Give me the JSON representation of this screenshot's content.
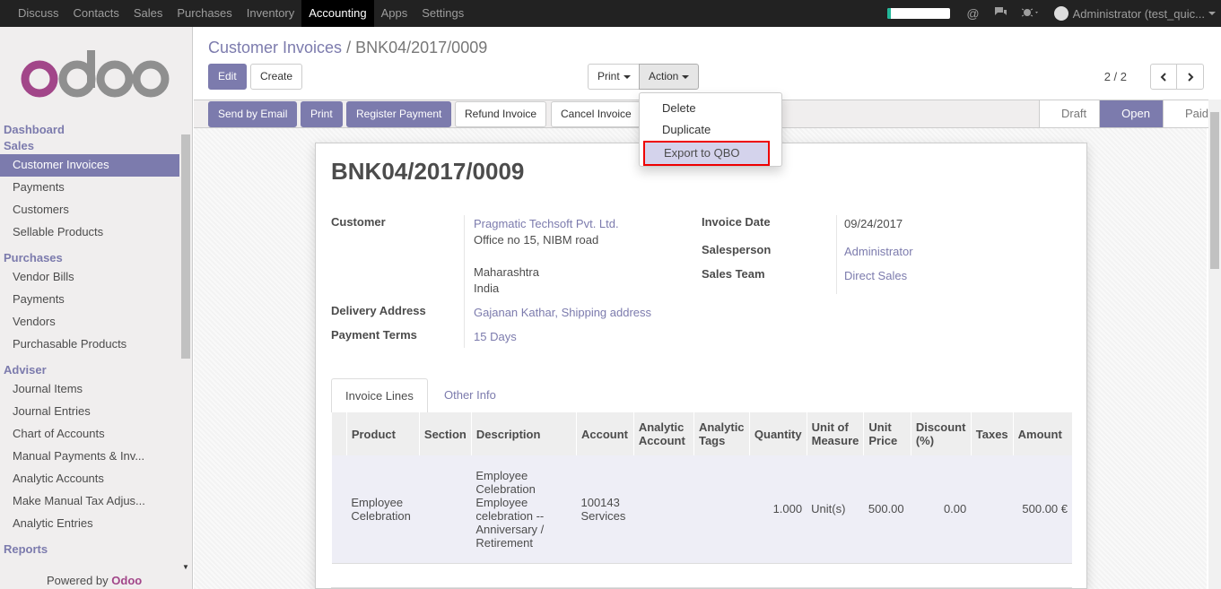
{
  "topbar": {
    "menu": [
      "Discuss",
      "Contacts",
      "Sales",
      "Purchases",
      "Inventory",
      "Accounting",
      "Apps",
      "Settings"
    ],
    "active": "Accounting",
    "user": "Administrator (test_quic...",
    "progress": 0.05
  },
  "sidebar": {
    "sections": [
      {
        "title": "Dashboard",
        "items": []
      },
      {
        "title": "Sales",
        "items": [
          "Customer Invoices",
          "Payments",
          "Customers",
          "Sellable Products"
        ]
      },
      {
        "title": "Purchases",
        "items": [
          "Vendor Bills",
          "Payments",
          "Vendors",
          "Purchasable Products"
        ]
      },
      {
        "title": "Adviser",
        "items": [
          "Journal Items",
          "Journal Entries",
          "Chart of Accounts",
          "Manual Payments & Inv...",
          "Analytic Accounts",
          "Make Manual Tax Adjus...",
          "Analytic Entries"
        ]
      },
      {
        "title": "Reports",
        "items": []
      }
    ],
    "active_item": "Customer Invoices",
    "powered_prefix": "Powered by",
    "powered_brand": "Odoo",
    "logo_text": "odoo"
  },
  "breadcrumb": {
    "parent": "Customer Invoices",
    "separator": "/",
    "current": "BNK04/2017/0009"
  },
  "buttons": {
    "edit": "Edit",
    "create": "Create",
    "print": "Print",
    "action": "Action"
  },
  "pager": {
    "value": "2 / 2"
  },
  "actionbar": {
    "send_email": "Send by Email",
    "print": "Print",
    "register_payment": "Register Payment",
    "refund": "Refund Invoice",
    "cancel": "Cancel Invoice"
  },
  "stages": [
    {
      "label": "Draft",
      "active": false
    },
    {
      "label": "Open",
      "active": true
    },
    {
      "label": "Paid",
      "active": false
    }
  ],
  "action_menu": {
    "items": [
      "Delete",
      "Duplicate",
      "Export to QBO"
    ],
    "highlighted": "Export to QBO"
  },
  "invoice": {
    "number": "BNK04/2017/0009",
    "customer_label": "Customer",
    "customer_name": "Pragmatic Techsoft Pvt. Ltd.",
    "address_line1": "Office no 15, NIBM road",
    "address_line2": "Maharashtra",
    "address_line3": "India",
    "delivery_label": "Delivery Address",
    "delivery_value": "Gajanan Kathar, Shipping address",
    "terms_label": "Payment Terms",
    "terms_value": "15 Days",
    "date_label": "Invoice Date",
    "date_value": "09/24/2017",
    "salesperson_label": "Salesperson",
    "salesperson_value": "Administrator",
    "team_label": "Sales Team",
    "team_value": "Direct Sales"
  },
  "tabs": {
    "lines": "Invoice Lines",
    "other": "Other Info"
  },
  "lines_table": {
    "headers": [
      "Product",
      "Section",
      "Description",
      "Account",
      "Analytic Account",
      "Analytic Tags",
      "Quantity",
      "Unit of Measure",
      "Unit Price",
      "Discount (%)",
      "Taxes",
      "Amount"
    ],
    "rows": [
      {
        "product": "Employee Celebration",
        "section": "",
        "description": "Employee Celebration Employee celebration -- Anniversary / Retirement",
        "account": "100143 Services",
        "analytic_account": "",
        "analytic_tags": "",
        "quantity": "1.000",
        "uom": "Unit(s)",
        "price": "500.00",
        "discount": "0.00",
        "taxes": "",
        "amount": "500.00 €"
      }
    ]
  },
  "colors": {
    "brand": "#7c7bad",
    "highlight_border": "#ee0000",
    "topbar": "#222222"
  }
}
